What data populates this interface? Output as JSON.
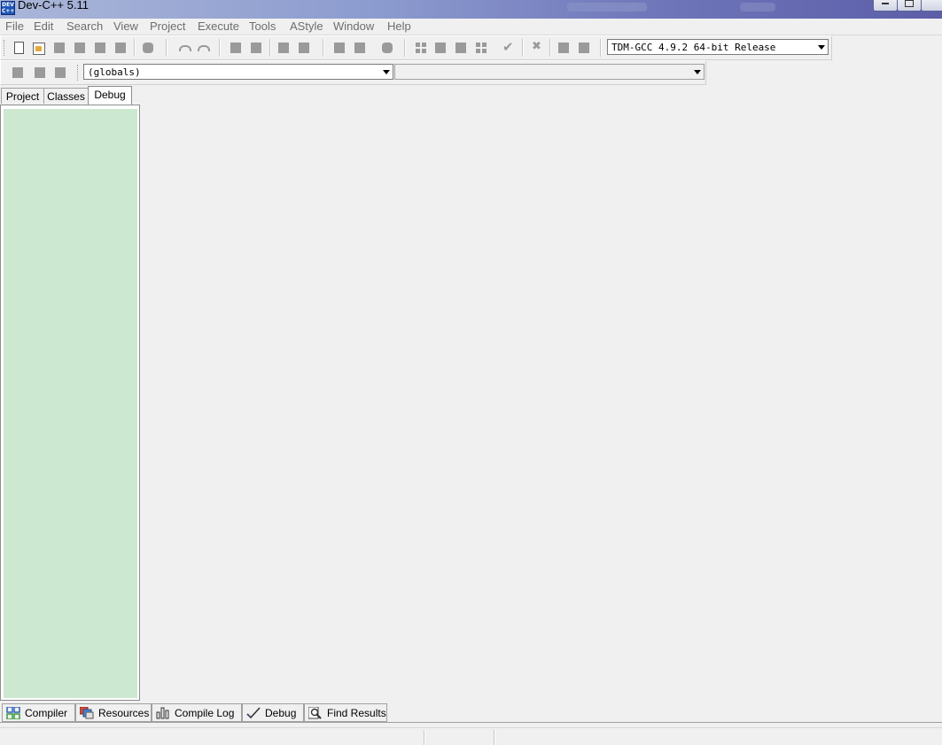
{
  "window": {
    "title": "Dev-C++ 5.11",
    "app_icon_text": "DEV C++"
  },
  "menu": [
    "File",
    "Edit",
    "Search",
    "View",
    "Project",
    "Execute",
    "Tools",
    "AStyle",
    "Window",
    "Help"
  ],
  "toolbar": {
    "compiler_select": "TDM-GCC 4.9.2 64-bit Release",
    "scope_select": "(globals)",
    "member_select": ""
  },
  "left_tabs": [
    {
      "label": "Project",
      "active": false
    },
    {
      "label": "Classes",
      "active": false
    },
    {
      "label": "Debug",
      "active": true
    }
  ],
  "bottom_tabs": [
    {
      "label": "Compiler",
      "icon": "compiler-grid-icon"
    },
    {
      "label": "Resources",
      "icon": "resources-icon"
    },
    {
      "label": "Compile Log",
      "icon": "compile-log-chart-icon"
    },
    {
      "label": "Debug",
      "icon": "debug-check-icon"
    },
    {
      "label": "Find Results",
      "icon": "find-results-magnifier-icon"
    }
  ],
  "colors": {
    "debug_panel_bg": "#cde8d0",
    "title_gradient_end": "#5c5ea8"
  }
}
